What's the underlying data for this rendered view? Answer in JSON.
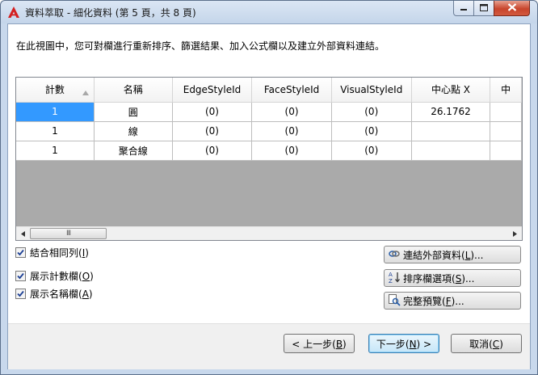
{
  "window": {
    "title": "資料萃取 - 細化資料 (第 5 頁，共 8 頁)"
  },
  "description": "在此視圖中，您可對欄進行重新排序、篩選結果、加入公式欄以及建立外部資料連結。",
  "grid": {
    "columns": [
      "計數",
      "名稱",
      "EdgeStyleId",
      "FaceStyleId",
      "VisualStyleId",
      "中心點 X",
      "中"
    ],
    "rows": [
      [
        "1",
        "圓",
        "(0)",
        "(0)",
        "(0)",
        "26.1762",
        ""
      ],
      [
        "1",
        "線",
        "(0)",
        "(0)",
        "(0)",
        "",
        ""
      ],
      [
        "1",
        "聚合線",
        "(0)",
        "(0)",
        "(0)",
        "",
        ""
      ]
    ],
    "scroll_thumb_glyph": "III"
  },
  "options": {
    "combine_rows": {
      "label": "結合相同列(",
      "key": "I",
      "tail": ")",
      "checked": true
    },
    "show_count": {
      "label": "展示計數欄(",
      "key": "O",
      "tail": ")",
      "checked": true
    },
    "show_name": {
      "label": "展示名稱欄(",
      "key": "A",
      "tail": ")",
      "checked": true
    }
  },
  "side_buttons": {
    "link_external": {
      "label": "連結外部資料(",
      "key": "L",
      "tail": ")..."
    },
    "sort_options": {
      "label": "排序欄選項(",
      "key": "S",
      "tail": ")..."
    },
    "full_preview": {
      "label": "完整預覽(",
      "key": "F",
      "tail": ")..."
    }
  },
  "buttons": {
    "back": {
      "label": "< 上一步(",
      "key": "B",
      "tail": ")"
    },
    "next": {
      "label": "下一步(",
      "key": "N",
      "tail": ") >"
    },
    "cancel": {
      "label": "取消(",
      "key": "C",
      "tail": ")"
    }
  },
  "colors": {
    "selection": "#3399ff",
    "grid_empty": "#aaaaaa",
    "close_button": "#c8452c",
    "app_icon": "#d42020"
  },
  "icons": {
    "app": "autocad-a-icon",
    "minimize": "minimize-icon",
    "maximize": "maximize-icon",
    "close": "close-icon",
    "link": "link-data-icon",
    "sort": "sort-az-icon",
    "preview": "preview-icon"
  }
}
